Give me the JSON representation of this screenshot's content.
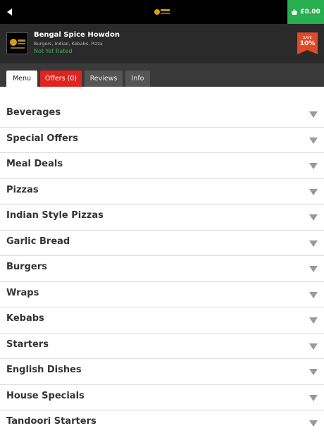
{
  "topbar": {
    "back_icon": "back-arrow-icon",
    "cart_icon": "shopping-basket-icon",
    "cart_total": "£0.00",
    "accent_color": "#27ae4f"
  },
  "restaurant": {
    "name": "Bengal Spice Howdon",
    "cuisines": "Burgers, Indian, Kebabs, Pizza",
    "rating": "Not Yet Rated",
    "rating_color": "#3fae5a"
  },
  "save_badge": {
    "label": "SAVE",
    "percent": "10%",
    "color": "#e04a2a"
  },
  "tabs": [
    {
      "label": "Menu",
      "active": true
    },
    {
      "label": "Offers (0)",
      "color": "#e0231f"
    },
    {
      "label": "Reviews"
    },
    {
      "label": "Info"
    }
  ],
  "menu": {
    "chevron_icon": "chevron-down-icon",
    "categories": [
      "Beverages",
      "Special Offers",
      "Meal Deals",
      "Pizzas",
      "Indian Style Pizzas",
      "Garlic Bread",
      "Burgers",
      "Wraps",
      "Kebabs",
      "Starters",
      "English Dishes",
      "House Specials",
      "Tandoori Starters"
    ]
  }
}
